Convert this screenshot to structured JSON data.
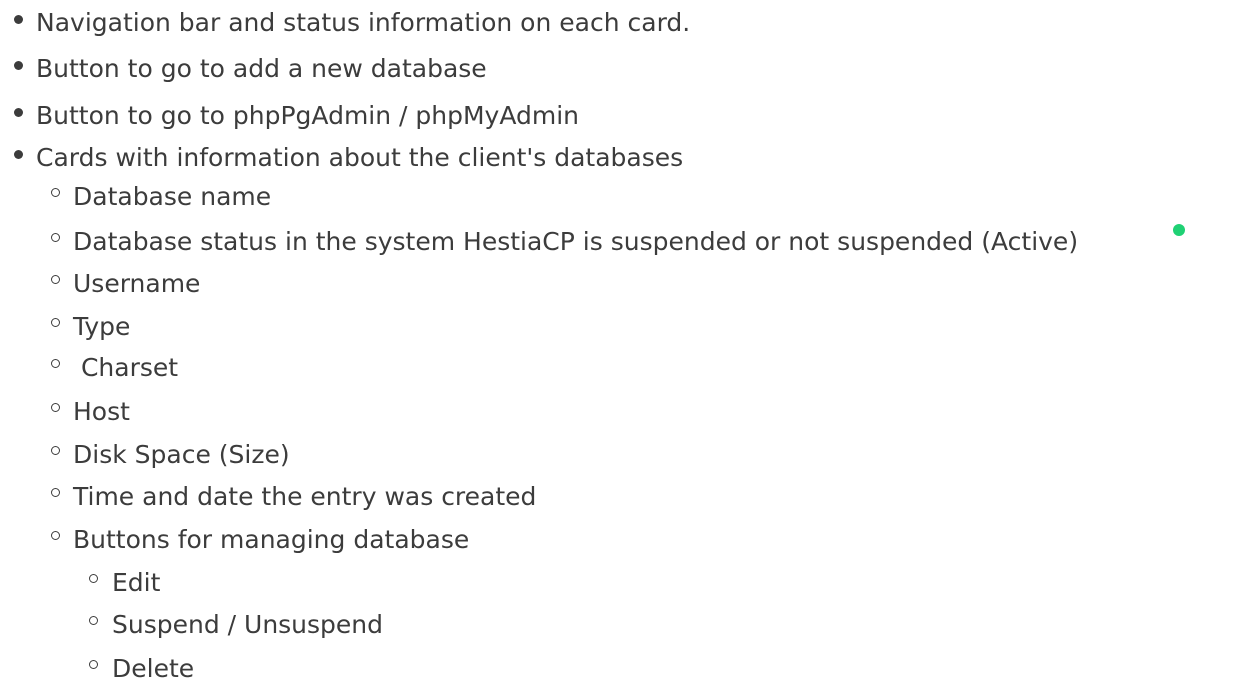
{
  "list": {
    "items": [
      {
        "text": "Navigation bar and status information on each card.",
        "level": 1
      },
      {
        "text": "Button to go to add a new database",
        "level": 1
      },
      {
        "text": "Button to go to phpPgAdmin / phpMyAdmin",
        "level": 1
      },
      {
        "text": "Cards with information about the client's databases",
        "level": 1
      },
      {
        "text": "Database name",
        "level": 2
      },
      {
        "text": "Database status in the system HestiaCP is suspended or not suspended (Active)",
        "level": 2
      },
      {
        "text": "Username",
        "level": 2
      },
      {
        "text": "Type",
        "level": 2
      },
      {
        "text": " Charset",
        "level": 2
      },
      {
        "text": "Host",
        "level": 2
      },
      {
        "text": "Disk Space (Size)",
        "level": 2
      },
      {
        "text": "Time and date the entry was created",
        "level": 2
      },
      {
        "text": "Buttons for managing database",
        "level": 2
      },
      {
        "text": "Edit",
        "level": 3
      },
      {
        "text": "Suspend / Unsuspend",
        "level": 3
      },
      {
        "text": "Delete",
        "level": 3
      }
    ]
  },
  "status_icon": {
    "name": "active-status-dot-icon",
    "color": "#1fd174"
  }
}
